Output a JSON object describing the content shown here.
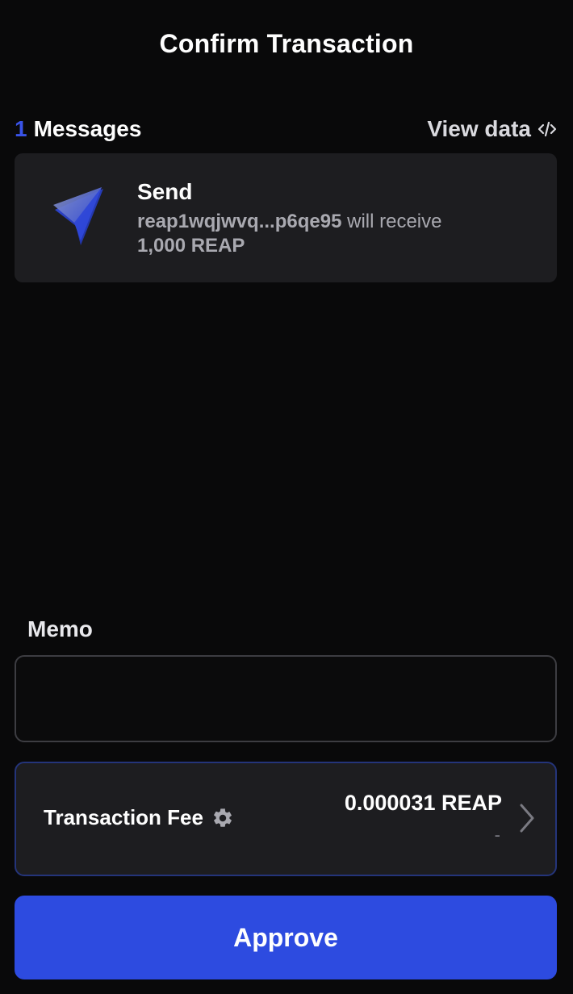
{
  "header": {
    "title": "Confirm Transaction"
  },
  "messages": {
    "count": "1",
    "label": "Messages",
    "view_data_label": "View data",
    "items": [
      {
        "type": "Send",
        "icon": "send-arrow-icon",
        "recipient": "reap1wqjwvq...p6qe95",
        "action_text": "will receive",
        "amount": "1,000 REAP"
      }
    ]
  },
  "memo": {
    "label": "Memo",
    "value": "",
    "placeholder": ""
  },
  "fee": {
    "label": "Transaction Fee",
    "amount": "0.000031 REAP",
    "fiat": "-"
  },
  "approve_button": {
    "label": "Approve"
  },
  "colors": {
    "background": "#09090a",
    "card": "#1d1d20",
    "accent": "#2d4be0",
    "count_accent": "#3953e8",
    "fee_border": "#24347a"
  }
}
